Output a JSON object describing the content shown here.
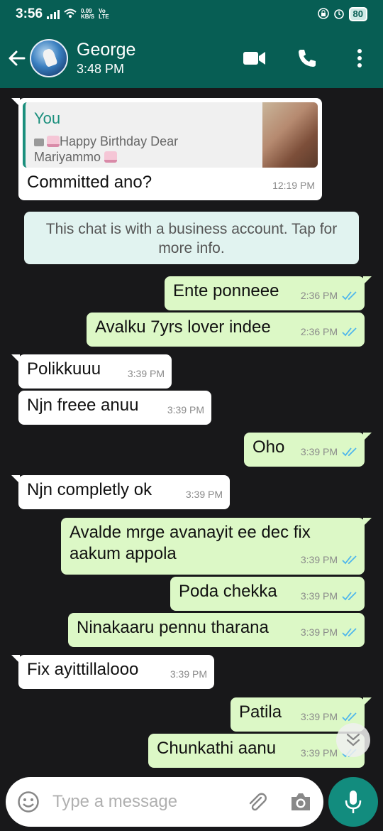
{
  "status_bar": {
    "time": "3:56",
    "net_speed": "0.09",
    "net_unit": "KB/S",
    "net_type_top": "Vo",
    "net_type_bottom": "LTE",
    "battery": "80"
  },
  "header": {
    "contact_name": "George",
    "last_seen": "3:48 PM"
  },
  "quoted_message": {
    "sender": "You",
    "text": "Happy Birthday Dear Mariyammo",
    "reply": "Committed ano?",
    "time": "12:19 PM"
  },
  "system_message": "This chat is with a business account. Tap for more info.",
  "messages": [
    {
      "text": "Ente ponneee",
      "time": "2:36 PM",
      "direction": "out"
    },
    {
      "text": "Avalku 7yrs lover indee",
      "time": "2:36 PM",
      "direction": "out"
    },
    {
      "text": "Polikkuuu",
      "time": "3:39 PM",
      "direction": "in"
    },
    {
      "text": "Njn freee anuu",
      "time": "3:39 PM",
      "direction": "in"
    },
    {
      "text": "Oho",
      "time": "3:39 PM",
      "direction": "out"
    },
    {
      "text": "Njn completly ok",
      "time": "3:39 PM",
      "direction": "in"
    },
    {
      "text": "Avalde mrge avanayit ee dec fix aakum appola",
      "time": "3:39 PM",
      "direction": "out"
    },
    {
      "text": "Poda chekka",
      "time": "3:39 PM",
      "direction": "out"
    },
    {
      "text": "Ninakaaru pennu tharana",
      "time": "3:39 PM",
      "direction": "out"
    },
    {
      "text": "Fix ayittillalooo",
      "time": "3:39 PM",
      "direction": "in"
    },
    {
      "text": "Patila",
      "time": "3:39 PM",
      "direction": "out"
    },
    {
      "text": "Chunkathi aanu",
      "time": "3:39 PM",
      "direction": "out"
    }
  ],
  "input": {
    "placeholder": "Type a message"
  },
  "colors": {
    "header": "#075e54",
    "outgoing_bubble": "#dcf8c6",
    "incoming_bubble": "#ffffff",
    "read_ticks": "#4fb6ec",
    "mic_button": "#128c7e"
  },
  "icons": [
    "back-arrow-icon",
    "video-call-icon",
    "voice-call-icon",
    "more-options-icon",
    "emoji-icon",
    "attach-icon",
    "camera-icon",
    "mic-icon",
    "scroll-down-icon"
  ]
}
